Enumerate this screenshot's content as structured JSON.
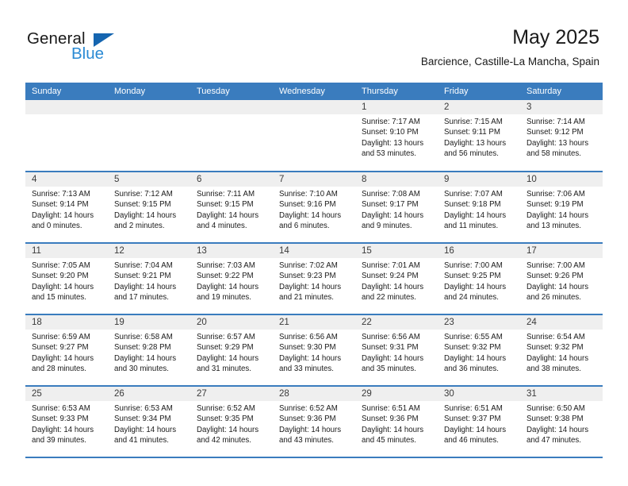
{
  "brand": {
    "name_part1": "General",
    "name_part2": "Blue",
    "logo_icon": "blue-triangle-logo"
  },
  "header": {
    "title": "May 2025",
    "subtitle": "Barcience, Castille-La Mancha, Spain"
  },
  "theme": {
    "header_blue": "#3a7cbe",
    "brand_blue": "#2a8ad4",
    "logo_blue": "#1565b0",
    "daynum_band": "#efefef",
    "text": "#1a1a1a"
  },
  "weekdays": [
    "Sunday",
    "Monday",
    "Tuesday",
    "Wednesday",
    "Thursday",
    "Friday",
    "Saturday"
  ],
  "labels": {
    "sunrise_prefix": "Sunrise:",
    "sunset_prefix": "Sunset:",
    "daylight_prefix": "Daylight:"
  },
  "weeks": [
    [
      {
        "day": "",
        "empty": true
      },
      {
        "day": "",
        "empty": true
      },
      {
        "day": "",
        "empty": true
      },
      {
        "day": "",
        "empty": true
      },
      {
        "day": "1",
        "sunrise": "Sunrise: 7:17 AM",
        "sunset": "Sunset: 9:10 PM",
        "daylight_l1": "Daylight: 13 hours",
        "daylight_l2": "and 53 minutes."
      },
      {
        "day": "2",
        "sunrise": "Sunrise: 7:15 AM",
        "sunset": "Sunset: 9:11 PM",
        "daylight_l1": "Daylight: 13 hours",
        "daylight_l2": "and 56 minutes."
      },
      {
        "day": "3",
        "sunrise": "Sunrise: 7:14 AM",
        "sunset": "Sunset: 9:12 PM",
        "daylight_l1": "Daylight: 13 hours",
        "daylight_l2": "and 58 minutes."
      }
    ],
    [
      {
        "day": "4",
        "sunrise": "Sunrise: 7:13 AM",
        "sunset": "Sunset: 9:14 PM",
        "daylight_l1": "Daylight: 14 hours",
        "daylight_l2": "and 0 minutes."
      },
      {
        "day": "5",
        "sunrise": "Sunrise: 7:12 AM",
        "sunset": "Sunset: 9:15 PM",
        "daylight_l1": "Daylight: 14 hours",
        "daylight_l2": "and 2 minutes."
      },
      {
        "day": "6",
        "sunrise": "Sunrise: 7:11 AM",
        "sunset": "Sunset: 9:15 PM",
        "daylight_l1": "Daylight: 14 hours",
        "daylight_l2": "and 4 minutes."
      },
      {
        "day": "7",
        "sunrise": "Sunrise: 7:10 AM",
        "sunset": "Sunset: 9:16 PM",
        "daylight_l1": "Daylight: 14 hours",
        "daylight_l2": "and 6 minutes."
      },
      {
        "day": "8",
        "sunrise": "Sunrise: 7:08 AM",
        "sunset": "Sunset: 9:17 PM",
        "daylight_l1": "Daylight: 14 hours",
        "daylight_l2": "and 9 minutes."
      },
      {
        "day": "9",
        "sunrise": "Sunrise: 7:07 AM",
        "sunset": "Sunset: 9:18 PM",
        "daylight_l1": "Daylight: 14 hours",
        "daylight_l2": "and 11 minutes."
      },
      {
        "day": "10",
        "sunrise": "Sunrise: 7:06 AM",
        "sunset": "Sunset: 9:19 PM",
        "daylight_l1": "Daylight: 14 hours",
        "daylight_l2": "and 13 minutes."
      }
    ],
    [
      {
        "day": "11",
        "sunrise": "Sunrise: 7:05 AM",
        "sunset": "Sunset: 9:20 PM",
        "daylight_l1": "Daylight: 14 hours",
        "daylight_l2": "and 15 minutes."
      },
      {
        "day": "12",
        "sunrise": "Sunrise: 7:04 AM",
        "sunset": "Sunset: 9:21 PM",
        "daylight_l1": "Daylight: 14 hours",
        "daylight_l2": "and 17 minutes."
      },
      {
        "day": "13",
        "sunrise": "Sunrise: 7:03 AM",
        "sunset": "Sunset: 9:22 PM",
        "daylight_l1": "Daylight: 14 hours",
        "daylight_l2": "and 19 minutes."
      },
      {
        "day": "14",
        "sunrise": "Sunrise: 7:02 AM",
        "sunset": "Sunset: 9:23 PM",
        "daylight_l1": "Daylight: 14 hours",
        "daylight_l2": "and 21 minutes."
      },
      {
        "day": "15",
        "sunrise": "Sunrise: 7:01 AM",
        "sunset": "Sunset: 9:24 PM",
        "daylight_l1": "Daylight: 14 hours",
        "daylight_l2": "and 22 minutes."
      },
      {
        "day": "16",
        "sunrise": "Sunrise: 7:00 AM",
        "sunset": "Sunset: 9:25 PM",
        "daylight_l1": "Daylight: 14 hours",
        "daylight_l2": "and 24 minutes."
      },
      {
        "day": "17",
        "sunrise": "Sunrise: 7:00 AM",
        "sunset": "Sunset: 9:26 PM",
        "daylight_l1": "Daylight: 14 hours",
        "daylight_l2": "and 26 minutes."
      }
    ],
    [
      {
        "day": "18",
        "sunrise": "Sunrise: 6:59 AM",
        "sunset": "Sunset: 9:27 PM",
        "daylight_l1": "Daylight: 14 hours",
        "daylight_l2": "and 28 minutes."
      },
      {
        "day": "19",
        "sunrise": "Sunrise: 6:58 AM",
        "sunset": "Sunset: 9:28 PM",
        "daylight_l1": "Daylight: 14 hours",
        "daylight_l2": "and 30 minutes."
      },
      {
        "day": "20",
        "sunrise": "Sunrise: 6:57 AM",
        "sunset": "Sunset: 9:29 PM",
        "daylight_l1": "Daylight: 14 hours",
        "daylight_l2": "and 31 minutes."
      },
      {
        "day": "21",
        "sunrise": "Sunrise: 6:56 AM",
        "sunset": "Sunset: 9:30 PM",
        "daylight_l1": "Daylight: 14 hours",
        "daylight_l2": "and 33 minutes."
      },
      {
        "day": "22",
        "sunrise": "Sunrise: 6:56 AM",
        "sunset": "Sunset: 9:31 PM",
        "daylight_l1": "Daylight: 14 hours",
        "daylight_l2": "and 35 minutes."
      },
      {
        "day": "23",
        "sunrise": "Sunrise: 6:55 AM",
        "sunset": "Sunset: 9:32 PM",
        "daylight_l1": "Daylight: 14 hours",
        "daylight_l2": "and 36 minutes."
      },
      {
        "day": "24",
        "sunrise": "Sunrise: 6:54 AM",
        "sunset": "Sunset: 9:32 PM",
        "daylight_l1": "Daylight: 14 hours",
        "daylight_l2": "and 38 minutes."
      }
    ],
    [
      {
        "day": "25",
        "sunrise": "Sunrise: 6:53 AM",
        "sunset": "Sunset: 9:33 PM",
        "daylight_l1": "Daylight: 14 hours",
        "daylight_l2": "and 39 minutes."
      },
      {
        "day": "26",
        "sunrise": "Sunrise: 6:53 AM",
        "sunset": "Sunset: 9:34 PM",
        "daylight_l1": "Daylight: 14 hours",
        "daylight_l2": "and 41 minutes."
      },
      {
        "day": "27",
        "sunrise": "Sunrise: 6:52 AM",
        "sunset": "Sunset: 9:35 PM",
        "daylight_l1": "Daylight: 14 hours",
        "daylight_l2": "and 42 minutes."
      },
      {
        "day": "28",
        "sunrise": "Sunrise: 6:52 AM",
        "sunset": "Sunset: 9:36 PM",
        "daylight_l1": "Daylight: 14 hours",
        "daylight_l2": "and 43 minutes."
      },
      {
        "day": "29",
        "sunrise": "Sunrise: 6:51 AM",
        "sunset": "Sunset: 9:36 PM",
        "daylight_l1": "Daylight: 14 hours",
        "daylight_l2": "and 45 minutes."
      },
      {
        "day": "30",
        "sunrise": "Sunrise: 6:51 AM",
        "sunset": "Sunset: 9:37 PM",
        "daylight_l1": "Daylight: 14 hours",
        "daylight_l2": "and 46 minutes."
      },
      {
        "day": "31",
        "sunrise": "Sunrise: 6:50 AM",
        "sunset": "Sunset: 9:38 PM",
        "daylight_l1": "Daylight: 14 hours",
        "daylight_l2": "and 47 minutes."
      }
    ]
  ]
}
